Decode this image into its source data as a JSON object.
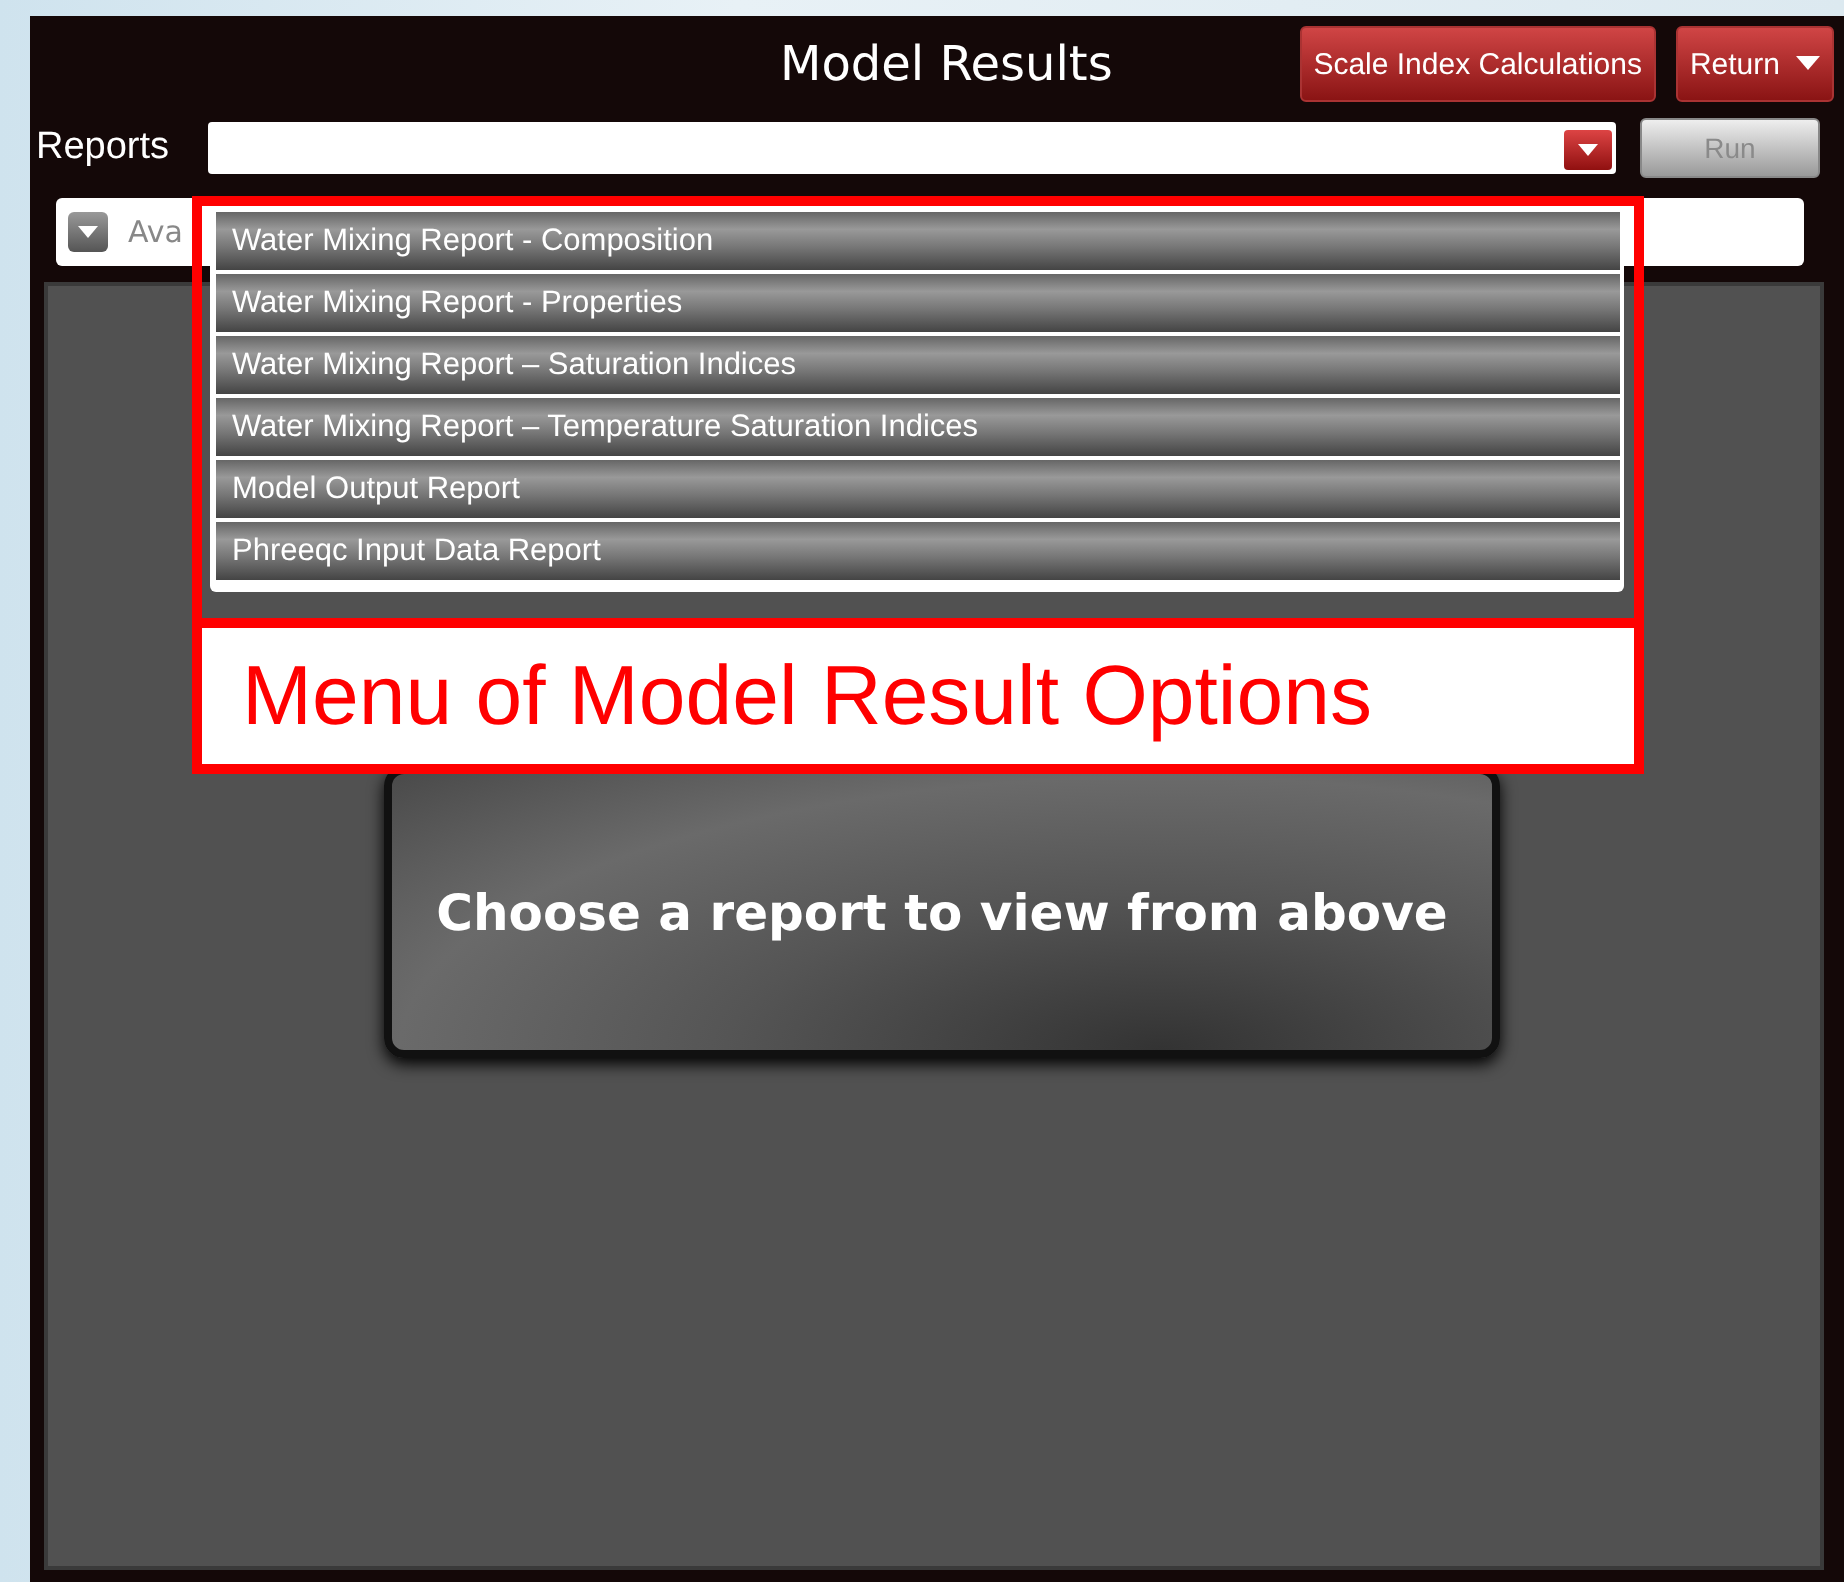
{
  "window": {
    "title": "Model Results"
  },
  "header_buttons": [
    {
      "label": "Scale Index Calculations",
      "kind": "plain"
    },
    {
      "label": "Return",
      "kind": "menu"
    }
  ],
  "reports": {
    "label": "Reports",
    "value_expanded": true,
    "run_button": {
      "label": "Run",
      "disabled": true
    }
  },
  "filter_bar": {
    "text": "Ava"
  },
  "report_options": [
    {
      "label": "Water Mixing Report - Composition"
    },
    {
      "label": "Water Mixing Report - Properties"
    },
    {
      "label": "Water Mixing Report – Saturation Indices"
    },
    {
      "label": "Water Mixing Report – Temperature Saturation Indices"
    },
    {
      "label": "Model Output Report"
    },
    {
      "label": "Phreeqc Input Data Report"
    }
  ],
  "annotation": {
    "text": "Menu of Model Result Options"
  },
  "placeholder_card": {
    "text": "Choose a report to view from above"
  }
}
